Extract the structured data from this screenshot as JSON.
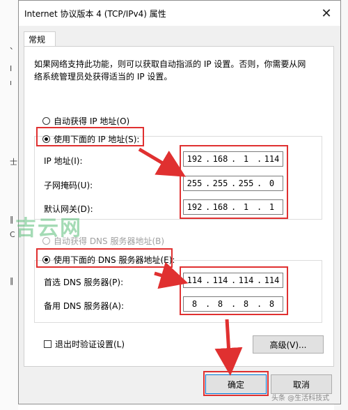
{
  "window": {
    "title": "Internet 协议版本 4 (TCP/IPv4) 属性",
    "close_glyph": "✕"
  },
  "tabs": [
    {
      "label": "常规"
    }
  ],
  "description": {
    "line1": "如果网络支持此功能，则可以获取自动指派的 IP 设置。否则，你需要从网",
    "line2": "络系统管理员处获得适当的 IP 设置。"
  },
  "ip_section": {
    "auto_label": "自动获得 IP 地址(O)",
    "auto_selected": false,
    "manual_label": "使用下面的 IP 地址(S):",
    "manual_selected": true,
    "fields": [
      {
        "label": "IP 地址(I):",
        "octets": [
          "192",
          "168",
          "1",
          "114"
        ]
      },
      {
        "label": "子网掩码(U):",
        "octets": [
          "255",
          "255",
          "255",
          "0"
        ]
      },
      {
        "label": "默认网关(D):",
        "octets": [
          "192",
          "168",
          "1",
          "1"
        ]
      }
    ]
  },
  "dns_section": {
    "auto_label": "自动获得 DNS 服务器地址(B)",
    "auto_selected": false,
    "auto_disabled": true,
    "manual_label": "使用下面的 DNS 服务器地址(E):",
    "manual_selected": true,
    "fields": [
      {
        "label": "首选 DNS 服务器(P):",
        "octets": [
          "114",
          "114",
          "114",
          "114"
        ]
      },
      {
        "label": "备用 DNS 服务器(A):",
        "octets": [
          "8",
          "8",
          "8",
          "8"
        ]
      }
    ]
  },
  "validate_on_exit": {
    "label": "退出时验证设置(L)",
    "checked": false
  },
  "buttons": {
    "advanced": "高级(V)...",
    "ok": "确定",
    "cancel": "取消"
  },
  "background": {
    "chars": [
      "、",
      "I",
      "ı",
      "士",
      "‖",
      "C",
      "‖"
    ]
  },
  "watermarks": {
    "center": "吉云网",
    "footer": "头条 @生活科技式"
  },
  "colors": {
    "highlight_red": "#e03030",
    "dialog_bg": "#f0f0f0",
    "panel_bg": "#ffffff",
    "watermark_green": "#5abe78"
  }
}
